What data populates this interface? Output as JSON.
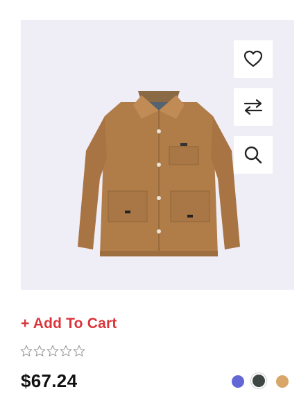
{
  "product": {
    "image_alt": "Tan button-up jacket",
    "add_to_cart_label": "+ Add To Cart",
    "price": "$67.24",
    "rating": {
      "value": 0,
      "max": 5
    },
    "actions": [
      {
        "name": "wishlist",
        "icon": "heart-icon"
      },
      {
        "name": "compare",
        "icon": "arrows-swap-icon"
      },
      {
        "name": "quick-view",
        "icon": "magnifier-icon"
      }
    ],
    "colors": [
      {
        "hex": "#6367d6",
        "selected": false
      },
      {
        "hex": "#3f4744",
        "selected": true
      },
      {
        "hex": "#d8a668",
        "selected": false
      }
    ]
  }
}
